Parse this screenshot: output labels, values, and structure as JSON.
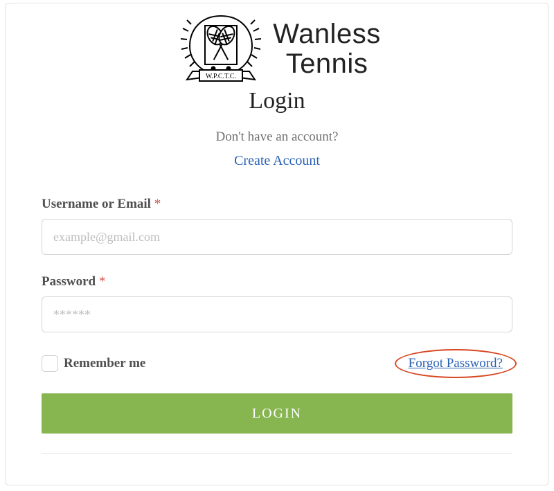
{
  "logo": {
    "brand_line1": "Wanless",
    "brand_line2": "Tennis",
    "crest_text": "W.P.C.T.C."
  },
  "header": {
    "title": "Login",
    "no_account_text": "Don't have an account?",
    "create_link": "Create Account"
  },
  "form": {
    "username_label": "Username or Email",
    "username_placeholder": "example@gmail.com",
    "username_value": "",
    "password_label": "Password",
    "password_placeholder": "******",
    "password_value": "",
    "required_mark": "*",
    "remember_label": "Remember me",
    "forgot_link": "Forgot Password?",
    "login_button": "LOGIN"
  }
}
